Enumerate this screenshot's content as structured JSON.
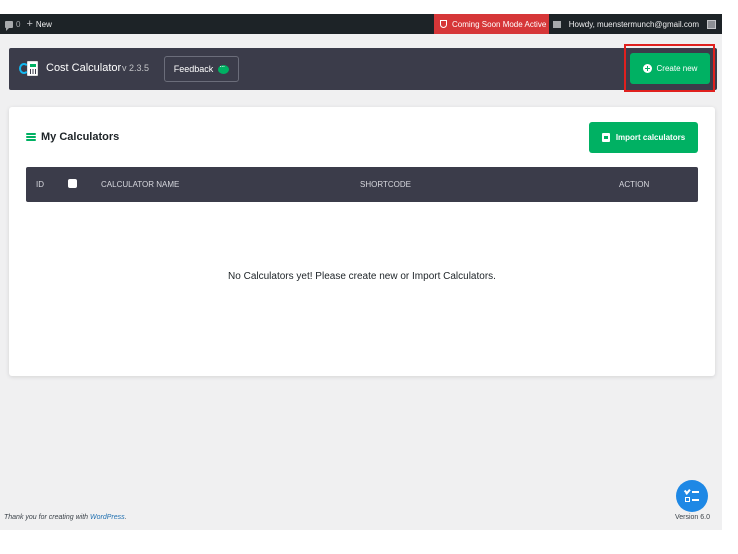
{
  "admin_bar": {
    "comments_count": "0",
    "new_label": "New",
    "coming_soon": "Coming Soon Mode Active",
    "greeting": "Howdy, muenstermunch@gmail.com"
  },
  "header": {
    "app_name": "Cost Calculator",
    "version": "v 2.3.5",
    "feedback_label": "Feedback",
    "create_label": "Create new"
  },
  "calculators": {
    "title": "My Calculators",
    "import_label": "Import calculators",
    "columns": {
      "id": "ID",
      "name": "CALCULATOR NAME",
      "shortcode": "SHORTCODE",
      "action": "ACTION"
    },
    "empty_message": "No Calculators yet! Please create new or Import Calculators."
  },
  "footer": {
    "thanks_prefix": "Thank you for creating with ",
    "wordpress_link": "WordPress",
    "thanks_suffix": ".",
    "version": "Version 6.0"
  },
  "colors": {
    "accent_green": "#00b163",
    "header_dark": "#3b3c4a",
    "highlight_red": "#e0201e",
    "fab_blue": "#1e88e5"
  }
}
